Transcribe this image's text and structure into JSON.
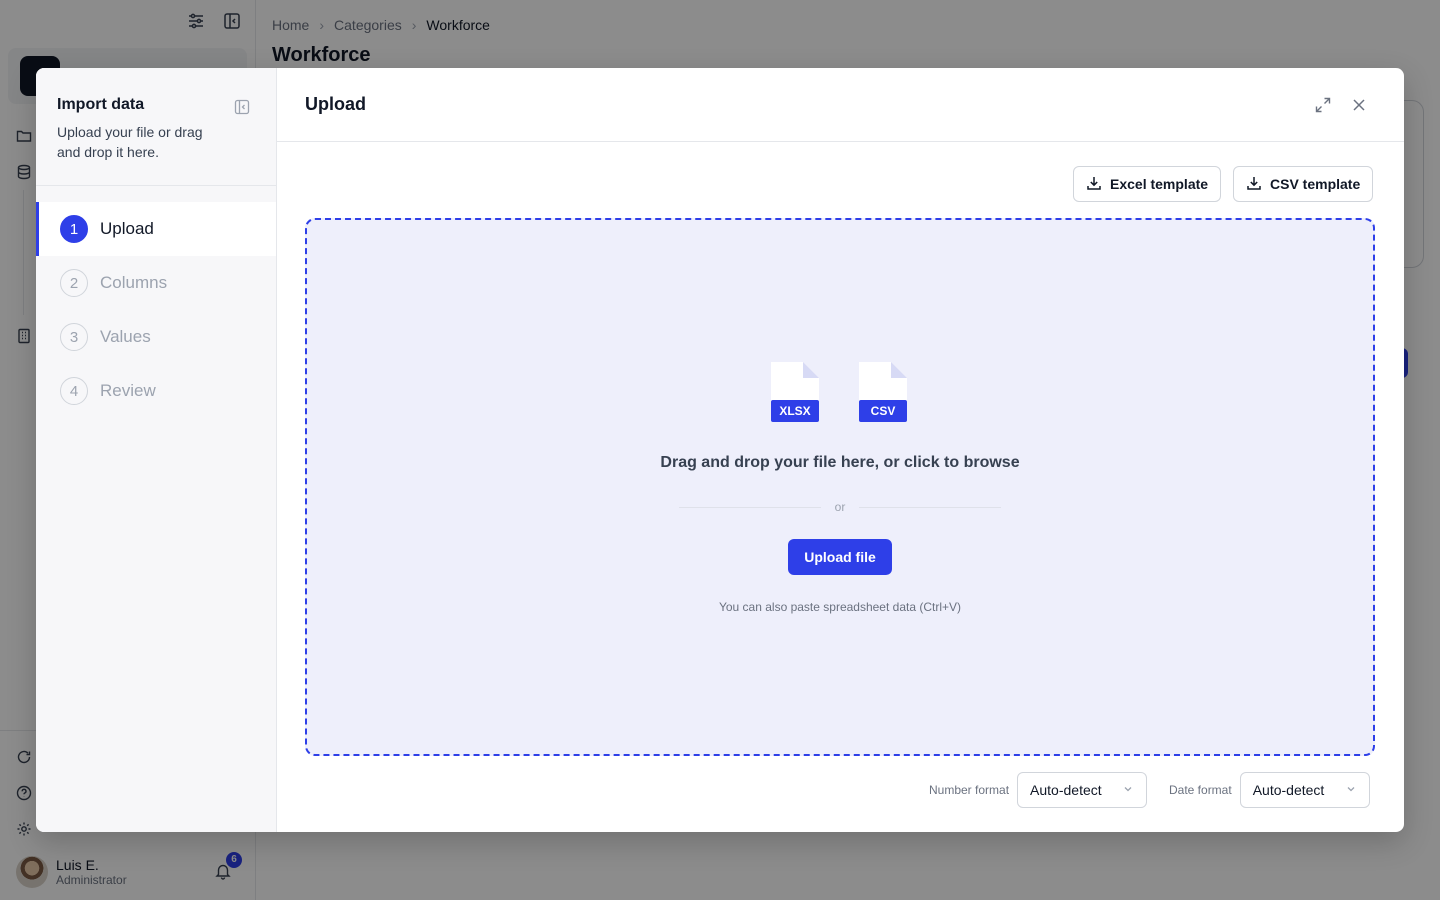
{
  "breadcrumb": {
    "home": "Home",
    "categories": "Categories",
    "current": "Workforce"
  },
  "page_title": "Workforce",
  "user": {
    "name": "Luis E.",
    "role": "Administrator",
    "notifications": "6"
  },
  "modal": {
    "sidebar": {
      "title": "Import data",
      "subtitle": "Upload your file or drag and drop it here.",
      "steps": [
        {
          "num": "1",
          "label": "Upload",
          "active": true
        },
        {
          "num": "2",
          "label": "Columns",
          "active": false
        },
        {
          "num": "3",
          "label": "Values",
          "active": false
        },
        {
          "num": "4",
          "label": "Review",
          "active": false
        }
      ]
    },
    "title": "Upload",
    "excel_template": "Excel template",
    "csv_template": "CSV template",
    "dropzone": {
      "file_types": [
        "XLSX",
        "CSV"
      ],
      "text": "Drag and drop your file here, or click to browse",
      "or": "or",
      "upload_button": "Upload file",
      "paste_hint": "You can also paste spreadsheet data (Ctrl+V)"
    },
    "number_format": {
      "label": "Number format",
      "value": "Auto-detect"
    },
    "date_format": {
      "label": "Date format",
      "value": "Auto-detect"
    }
  },
  "colors": {
    "accent": "#2e3fe8",
    "dropzone_bg": "#eeeffb",
    "overlay": "rgba(0,0,0,0.45)"
  }
}
